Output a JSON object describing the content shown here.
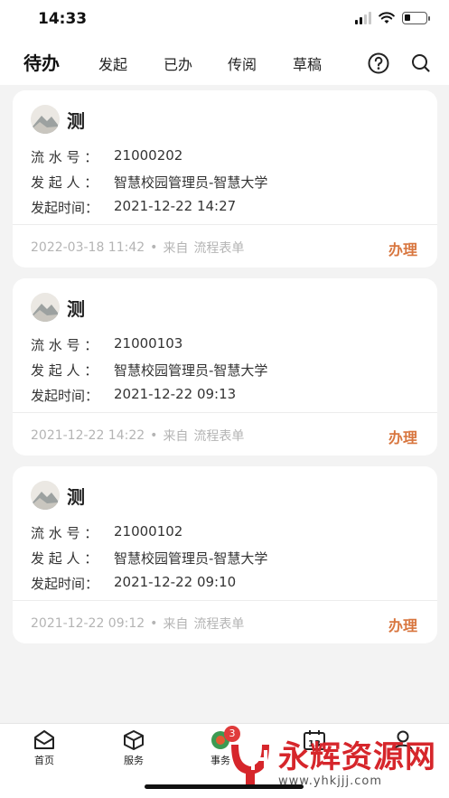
{
  "status_bar": {
    "time": "14:33"
  },
  "tabs": [
    {
      "label": "待办",
      "active": true
    },
    {
      "label": "发起"
    },
    {
      "label": "已办"
    },
    {
      "label": "传阅"
    },
    {
      "label": "草稿"
    }
  ],
  "icons": {
    "help": "question-circle-icon",
    "search": "search-icon"
  },
  "colors": {
    "accent": "#d8763f",
    "badge": "#e03b3b",
    "watermark": "#d6262b"
  },
  "cards": [
    {
      "title": "测",
      "serial_label": "流 水 号 ：",
      "serial": "21000202",
      "initiator_label": "发 起 人 ：",
      "initiator": "智慧校园管理员-智慧大学",
      "time_label": "发起时间：",
      "time": "2021-12-22 14:27",
      "footer_time": "2022-03-18 11:42",
      "dot": "•",
      "source_label": "来自",
      "source": "流程表单",
      "action": "办理"
    },
    {
      "title": "测",
      "serial_label": "流 水 号 ：",
      "serial": "21000103",
      "initiator_label": "发 起 人 ：",
      "initiator": "智慧校园管理员-智慧大学",
      "time_label": "发起时间：",
      "time": "2021-12-22 09:13",
      "footer_time": "2021-12-22 14:22",
      "dot": "•",
      "source_label": "来自",
      "source": "流程表单",
      "action": "办理"
    },
    {
      "title": "测",
      "serial_label": "流 水 号 ：",
      "serial": "21000102",
      "initiator_label": "发 起 人 ：",
      "initiator": "智慧校园管理员-智慧大学",
      "time_label": "发起时间：",
      "time": "2021-12-22 09:10",
      "footer_time": "2021-12-22 09:12",
      "dot": "•",
      "source_label": "来自",
      "source": "流程表单",
      "action": "办理"
    }
  ],
  "bottom_nav": [
    {
      "label": "首页",
      "icon": "home-icon"
    },
    {
      "label": "服务",
      "icon": "cube-icon"
    },
    {
      "label": "事务",
      "icon": "tasks-icon",
      "badge": "3"
    },
    {
      "label": "",
      "icon": "calendar-icon",
      "calendar_day": "13"
    },
    {
      "label": "",
      "icon": "user-icon"
    }
  ],
  "watermark": {
    "main": "永辉资源网",
    "url": "www.yhkjjj.com"
  }
}
